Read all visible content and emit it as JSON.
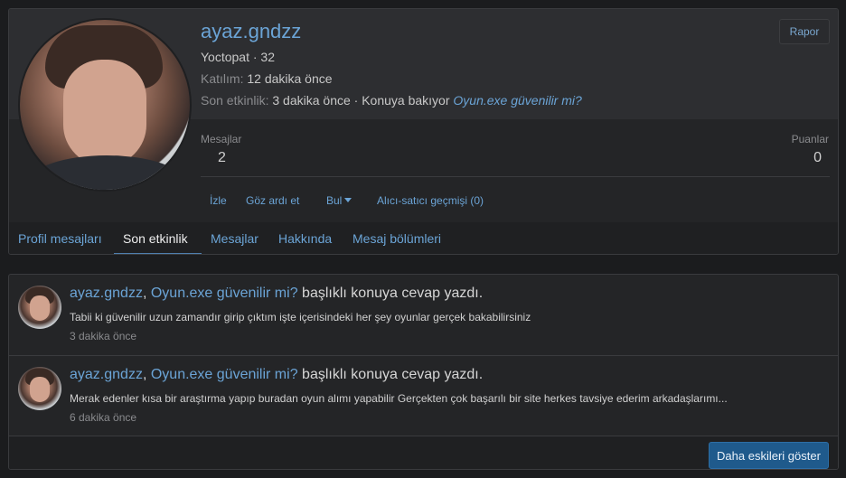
{
  "profile": {
    "username": "ayaz.gndzz",
    "role_line": "Yoctopat · 32",
    "joined_label": "Katılım:",
    "joined_value": "12 dakika önce",
    "last_activity_label": "Son etkinlik:",
    "last_activity_value": "3 dakika önce · Konuya bakıyor",
    "last_activity_thread": "Oyun.exe güvenilir mi?",
    "report_button": "Rapor",
    "stats": {
      "messages_label": "Mesajlar",
      "messages_value": "2",
      "points_label": "Puanlar",
      "points_value": "0"
    },
    "actions": {
      "follow": "İzle",
      "ignore": "Göz ardı et",
      "find": "Bul",
      "trader_history": "Alıcı-satıcı geçmişi (0)"
    },
    "tabs": [
      {
        "label": "Profil mesajları",
        "active": false
      },
      {
        "label": "Son etkinlik",
        "active": true
      },
      {
        "label": "Mesajlar",
        "active": false
      },
      {
        "label": "Hakkında",
        "active": false
      },
      {
        "label": "Mesaj bölümleri",
        "active": false
      }
    ]
  },
  "feed": {
    "items": [
      {
        "user": "ayaz.gndzz",
        "separator": ",",
        "thread": "Oyun.exe güvenilir mi?",
        "action": "başlıklı konuya cevap yazdı.",
        "snippet": "Tabii ki güvenilir uzun zamandır girip çıktım işte içerisindeki her şey oyunlar gerçek bakabilirsiniz",
        "time": "3 dakika önce"
      },
      {
        "user": "ayaz.gndzz",
        "separator": ",",
        "thread": "Oyun.exe güvenilir mi?",
        "action": "başlıklı konuya cevap yazdı.",
        "snippet": "Merak edenler kısa bir araştırma yapıp buradan oyun alımı yapabilir Gerçekten çok başarılı bir site herkes tavsiye ederim arkadaşlarımı...",
        "time": "6 dakika önce"
      }
    ],
    "more_button": "Daha eskileri göster"
  },
  "colors": {
    "link": "#6ba4d6",
    "primary_button": "#1f5a8c",
    "background": "#1b1c1e",
    "card": "#242527"
  }
}
